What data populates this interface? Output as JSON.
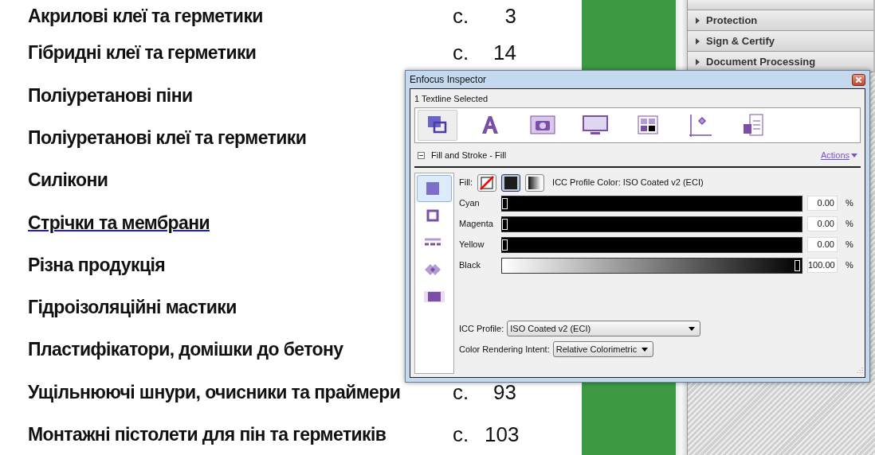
{
  "toc": [
    {
      "title": "Акрилові клеї та герметики",
      "page_prefix": "с.",
      "page": "3"
    },
    {
      "title": "Гібридні клеї та герметики",
      "page_prefix": "с.",
      "page": "14"
    },
    {
      "title": "Поліуретанові піни"
    },
    {
      "title": "Поліуретанові клеї та герметики"
    },
    {
      "title": "Силікони"
    },
    {
      "title": "Стрічки та мембрани",
      "selected": true
    },
    {
      "title": "Різна продукція"
    },
    {
      "title": "Гідроізоляційні мастики"
    },
    {
      "title": "Пластифікатори, домішки до бетону"
    },
    {
      "title": "Ущільнюючі шнури, очисники та праймери",
      "page_prefix": "с.",
      "page": "93"
    },
    {
      "title": "Монтажні пістолети для пін та герметиків",
      "page_prefix": "с.",
      "page": "103"
    }
  ],
  "panel": {
    "items": [
      {
        "label": "Protection"
      },
      {
        "label": "Sign & Certify"
      },
      {
        "label": "Document Processing"
      }
    ]
  },
  "inspector": {
    "title": "Enfocus Inspector",
    "selection": "1 Textline Selected",
    "tools": [
      {
        "kind": "fill-stroke",
        "selected": true
      },
      {
        "kind": "text",
        "selected": false
      },
      {
        "kind": "image",
        "selected": false
      },
      {
        "kind": "display",
        "selected": false
      },
      {
        "kind": "color",
        "selected": false
      },
      {
        "kind": "position",
        "selected": false
      },
      {
        "kind": "info",
        "selected": false
      }
    ],
    "section": {
      "title": "Fill and Stroke - Fill",
      "expanded": true,
      "actions": "Actions"
    },
    "side_tabs": [
      {
        "kind": "fill",
        "selected": true
      },
      {
        "kind": "stroke",
        "selected": false
      },
      {
        "kind": "dash",
        "selected": false
      },
      {
        "kind": "join",
        "selected": false
      },
      {
        "kind": "transparency",
        "selected": false
      }
    ],
    "fill_label": "Fill:",
    "fill_types": [
      {
        "kind": "none",
        "selected": false
      },
      {
        "kind": "solid",
        "selected": true
      },
      {
        "kind": "gradient",
        "selected": false
      }
    ],
    "color_caption": "ICC Profile Color: ISO Coated v2 (ECI)",
    "channels": [
      {
        "name": "Cyan",
        "kind": "solid",
        "level": 0,
        "value": "0.00",
        "unit": "%"
      },
      {
        "name": "Magenta",
        "kind": "solid",
        "level": 0,
        "value": "0.00",
        "unit": "%"
      },
      {
        "name": "Yellow",
        "kind": "solid",
        "level": 0,
        "value": "0.00",
        "unit": "%"
      },
      {
        "name": "Black",
        "kind": "gradient",
        "level": 1,
        "value": "100.00",
        "unit": "%"
      }
    ],
    "profile": {
      "label": "ICC Profile:",
      "value": "ISO Coated v2 (ECI)"
    },
    "intent": {
      "label": "Color Rendering Intent:",
      "value": "Relative Colorimetric"
    }
  }
}
